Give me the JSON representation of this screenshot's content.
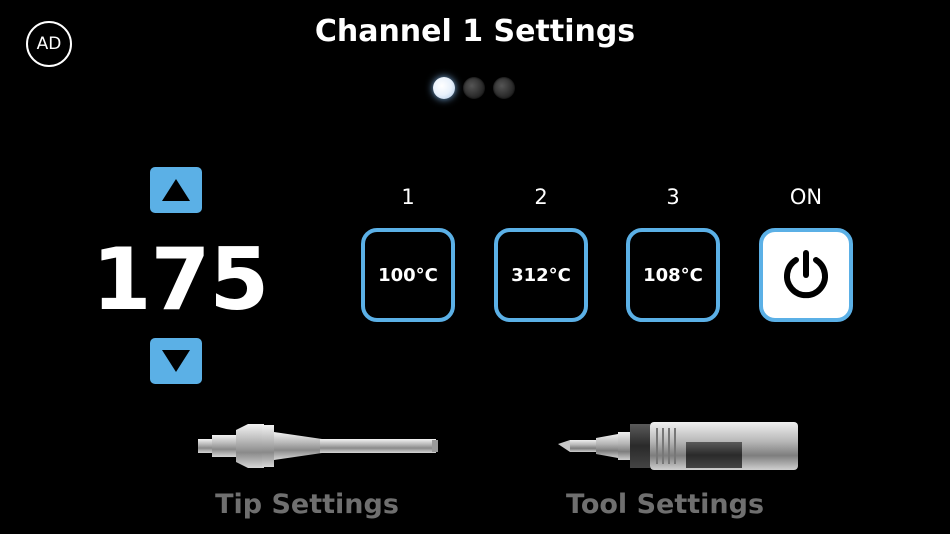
{
  "header": {
    "avatar_initials": "AD",
    "title": "Channel 1 Settings"
  },
  "pager": {
    "total_pages": 3,
    "active_page": 1
  },
  "setpoint": {
    "value": "175",
    "up_icon": "triangle-up-icon",
    "down_icon": "triangle-down-icon"
  },
  "presets": [
    {
      "label": "1",
      "value": "100°C"
    },
    {
      "label": "2",
      "value": "312°C"
    },
    {
      "label": "3",
      "value": "108°C"
    }
  ],
  "power": {
    "label": "ON",
    "icon": "power-icon"
  },
  "bottom": {
    "tip_label": "Tip Settings",
    "tool_label": "Tool Settings"
  },
  "colors": {
    "accent": "#5bb0e6",
    "background": "#000000",
    "muted_label": "#6f6f6f"
  }
}
